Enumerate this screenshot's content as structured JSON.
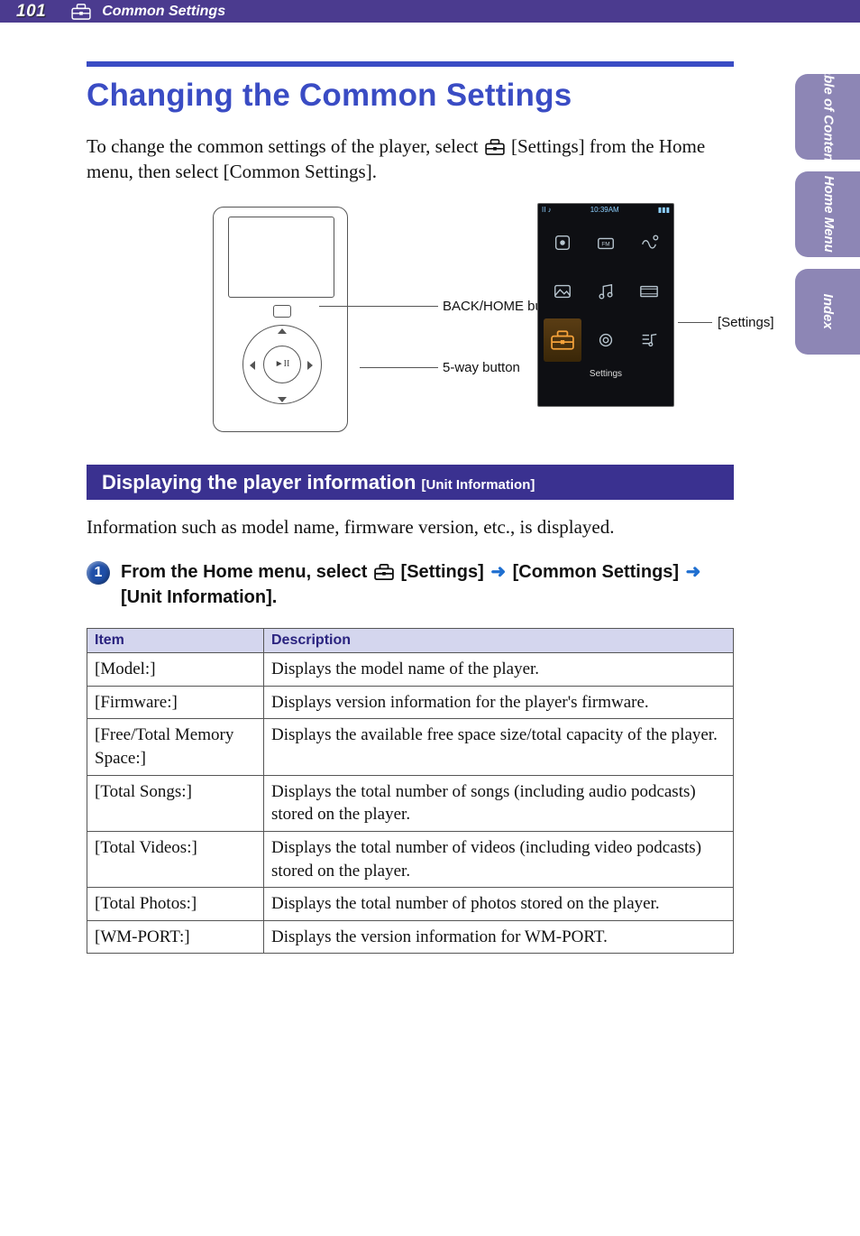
{
  "header": {
    "page_number": "101",
    "section_label": "Common Settings"
  },
  "side_tabs": {
    "tab1": "Table of\nContents",
    "tab2": "Home\nMenu",
    "tab3": "Index"
  },
  "title": "Changing the Common Settings",
  "intro_a": "To change the common settings of the player, select ",
  "intro_b": " [Settings] from the Home menu, then select [Common Settings].",
  "figure": {
    "back_home_label": "BACK/HOME button",
    "fiveway_label": "5-way button",
    "settings_label": "[Settings]",
    "hm_clock": "10:39AM",
    "hm_caption": "Settings"
  },
  "subsection": {
    "title_big": "Displaying the player information",
    "title_small": " [Unit Information]"
  },
  "sub_desc": "Information such as model name, firmware version, etc., is displayed.",
  "step": {
    "num": "1",
    "pre": "From the Home menu, select ",
    "s1": " [Settings] ",
    "s2": " [Common Settings] ",
    "s3": " [Unit Information]."
  },
  "table": {
    "h_item": "Item",
    "h_desc": "Description",
    "rows": [
      {
        "item": "[Model:]",
        "desc": "Displays the model name of the player."
      },
      {
        "item": "[Firmware:]",
        "desc": "Displays version information for the player's firmware."
      },
      {
        "item": "[Free/Total Memory Space:]",
        "desc": "Displays the available free space size/total capacity of the player."
      },
      {
        "item": "[Total Songs:]",
        "desc": "Displays the total number of songs (including audio podcasts) stored on the player."
      },
      {
        "item": "[Total Videos:]",
        "desc": "Displays the total number of videos (including video podcasts) stored on the player."
      },
      {
        "item": "[Total Photos:]",
        "desc": "Displays the total number of photos stored on the player."
      },
      {
        "item": "[WM-PORT:]",
        "desc": "Displays the version information for WM-PORT."
      }
    ]
  }
}
